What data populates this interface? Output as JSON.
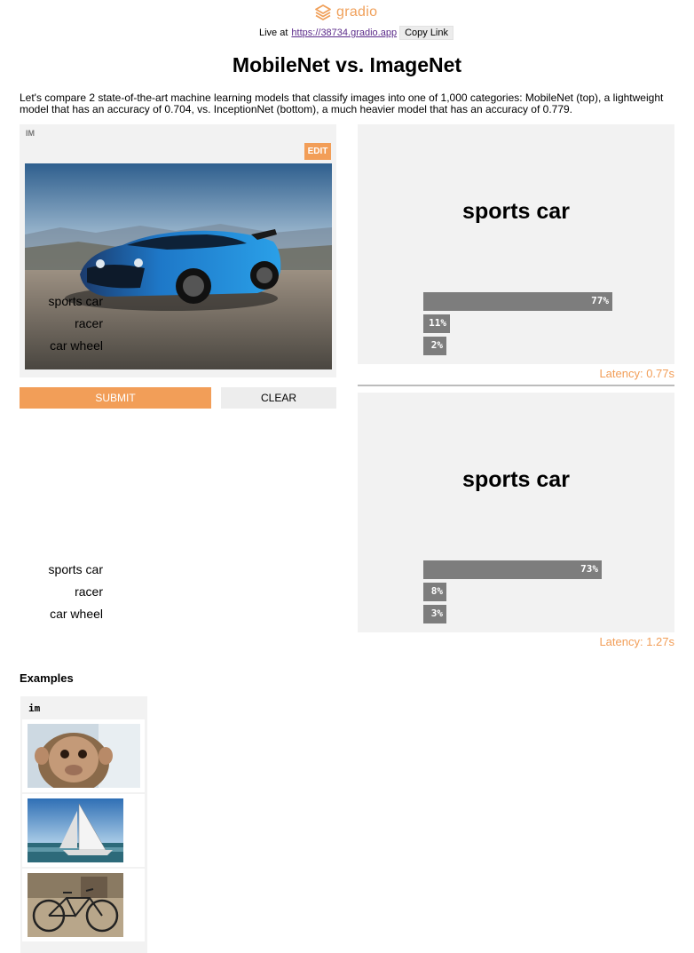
{
  "header": {
    "logo_text": "gradio",
    "live_prefix": "Live at",
    "live_url": "https://38734.gradio.app",
    "copy_link_label": "Copy Link"
  },
  "title": "MobileNet vs. ImageNet",
  "description": "Let's compare 2 state-of-the-art machine learning models that classify images into one of 1,000 categories: MobileNet (top), a lightweight model that has an accuracy of 0.704, vs. InceptionNet (bottom), a much heavier model that has an accuracy of 0.779.",
  "input": {
    "label": "IM",
    "edit_label": "EDIT",
    "image_desc": "blue sports car"
  },
  "buttons": {
    "submit": "SUBMIT",
    "clear": "CLEAR"
  },
  "outputs": [
    {
      "top_label": "sports car",
      "confidences": [
        {
          "label": "sports car",
          "value": 0.77,
          "text": "77%"
        },
        {
          "label": "racer",
          "value": 0.11,
          "text": "11%"
        },
        {
          "label": "car wheel",
          "value": 0.02,
          "text": "2%"
        }
      ],
      "latency": "Latency: 0.77s"
    },
    {
      "top_label": "sports car",
      "confidences": [
        {
          "label": "sports car",
          "value": 0.73,
          "text": "73%"
        },
        {
          "label": "racer",
          "value": 0.08,
          "text": "8%"
        },
        {
          "label": "car wheel",
          "value": 0.03,
          "text": "3%"
        }
      ],
      "latency": "Latency: 1.27s"
    }
  ],
  "examples": {
    "title": "Examples",
    "column": "im",
    "items": [
      "monkey",
      "sailboat",
      "bicycle"
    ]
  },
  "colors": {
    "accent": "#f29e58",
    "bar": "#7d7d7d",
    "panel_bg": "#f2f2f2",
    "car_blue": "#1e78c8"
  }
}
